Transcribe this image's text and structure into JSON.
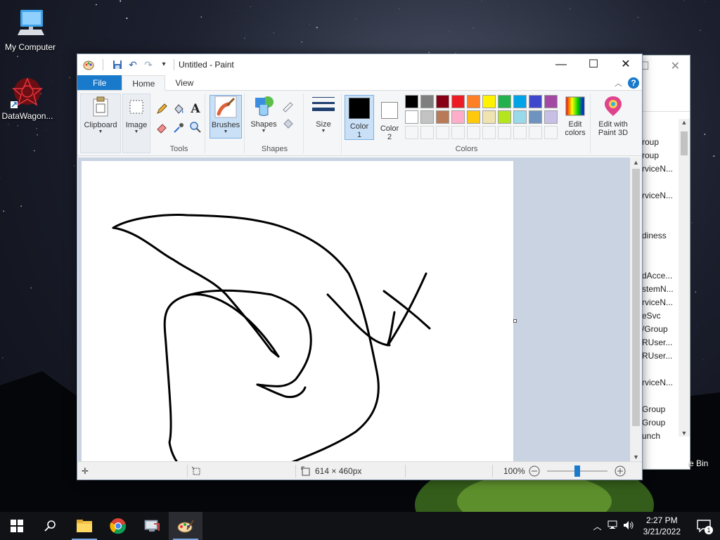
{
  "desktop": {
    "icons": [
      {
        "label": "My Computer"
      },
      {
        "label": "DataWagon..."
      }
    ],
    "recycle_label": "e Bin"
  },
  "background_window": {
    "items": [
      "roup",
      "roup",
      "rviceN...",
      "",
      "rviceN...",
      "",
      "",
      "diness",
      "",
      "",
      "dAcce...",
      "stemN...",
      "rviceN...",
      "eSvc",
      "/Group",
      "RUser...",
      "RUser...",
      "",
      "rviceN...",
      "",
      "Group",
      "Group",
      "unch"
    ]
  },
  "paint": {
    "title": "Untitled - Paint",
    "tabs": {
      "file": "File",
      "home": "Home",
      "view": "View"
    },
    "ribbon": {
      "clipboard": "Clipboard",
      "image": "Image",
      "tools": "Tools",
      "brushes": "Brushes",
      "shapes": "Shapes",
      "shapes_group": "Shapes",
      "size": "Size",
      "color1_line1": "Color",
      "color1_line2": "1",
      "color2_line1": "Color",
      "color2_line2": "2",
      "edit_colors_line1": "Edit",
      "edit_colors_line2": "colors",
      "paint3d_line1": "Edit with",
      "paint3d_line2": "Paint 3D",
      "colors_group": "Colors"
    },
    "palette_row1": [
      "#000000",
      "#7f7f7f",
      "#880015",
      "#ed1c24",
      "#ff7f27",
      "#fff200",
      "#22b14c",
      "#00a2e8",
      "#3f48cc",
      "#a349a4"
    ],
    "palette_row2": [
      "#ffffff",
      "#c3c3c3",
      "#b97a57",
      "#ffaec9",
      "#ffc90e",
      "#efe4b0",
      "#b5e61d",
      "#99d9ea",
      "#7092be",
      "#c8bfe7"
    ],
    "color1": "#000000",
    "color2": "#ffffff",
    "status": {
      "size": "614 × 460px",
      "zoom": "100%"
    },
    "zoom_level_fraction": 0.5
  },
  "taskbar": {
    "time": "2:27 PM",
    "date": "3/21/2022",
    "notification_count": "1"
  }
}
